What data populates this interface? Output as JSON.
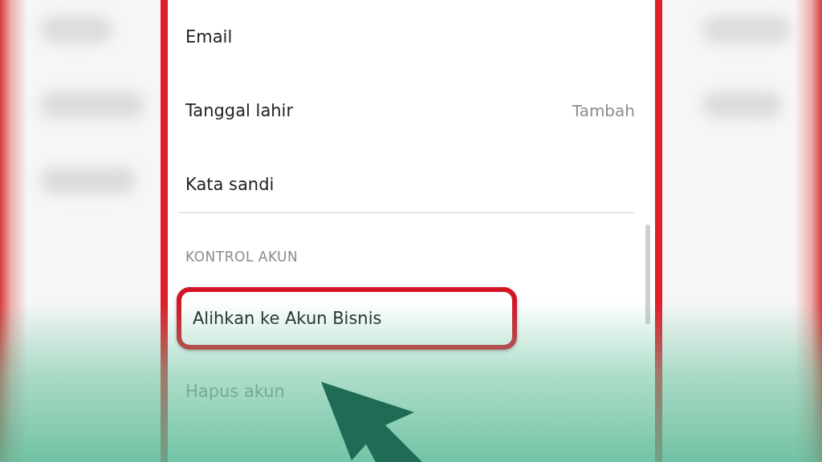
{
  "account_rows": [
    {
      "kind": "item",
      "label": "Email"
    },
    {
      "kind": "item",
      "label": "Tanggal lahir",
      "value": "Tambah"
    },
    {
      "kind": "item",
      "label": "Kata sandi"
    },
    {
      "kind": "divider"
    },
    {
      "kind": "header",
      "label": "KONTROL AKUN"
    },
    {
      "kind": "item",
      "label": "Alihkan ke Akun Bisnis",
      "highlighted": true
    },
    {
      "kind": "item",
      "label": "Hapus akun",
      "disabled": true
    }
  ]
}
